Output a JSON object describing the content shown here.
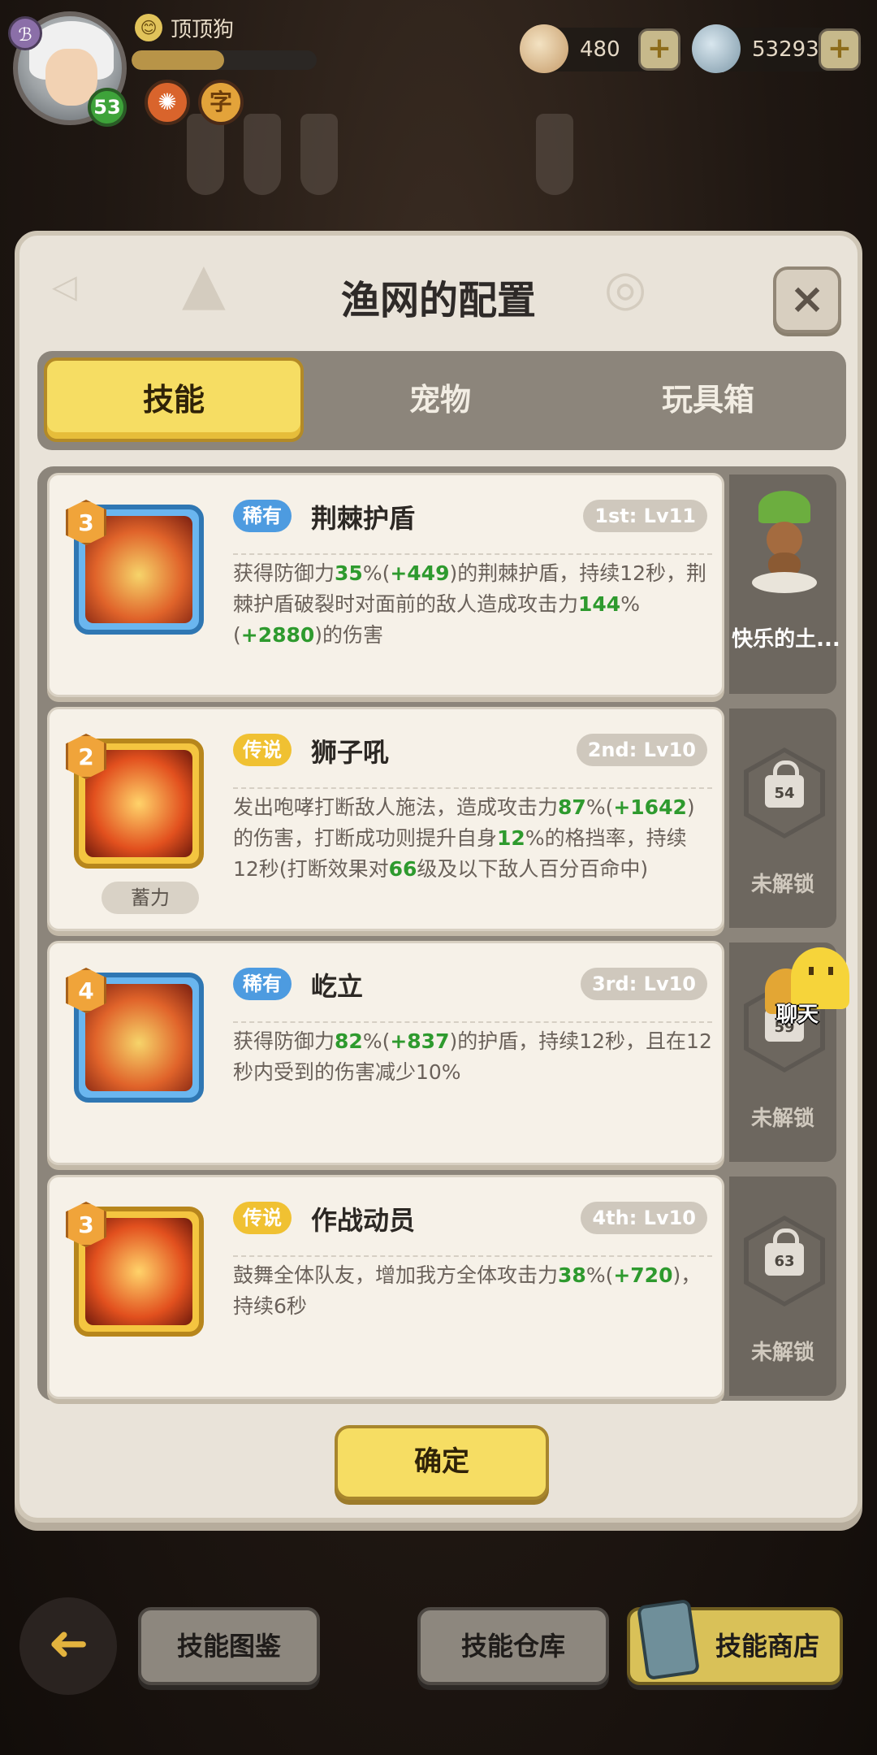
{
  "player": {
    "avatar_badge": "ℬ",
    "level": "53",
    "name_icon": "😊",
    "name": "顶顶狗",
    "xp_fraction": 0.5,
    "buffs": [
      {
        "icon": "✺"
      },
      {
        "icon": "字"
      }
    ]
  },
  "currencies": [
    {
      "name": "shell",
      "value": "480",
      "plus": "+"
    },
    {
      "name": "pearl",
      "value": "53293",
      "plus": "+"
    }
  ],
  "dialog": {
    "title": "渔网的配置",
    "close": "×",
    "tabs": [
      "技能",
      "宠物",
      "玩具箱"
    ],
    "active_tab": 0,
    "confirm": "确定"
  },
  "skills": [
    {
      "rank": "3",
      "rarity": "稀有",
      "rarity_type": "rare",
      "name": "荆棘护盾",
      "slot": "1st: Lv11",
      "desc": [
        {
          "t": "获得防御力"
        },
        {
          "t": "35",
          "h": true
        },
        {
          "t": "%("
        },
        {
          "t": "+449",
          "h": true
        },
        {
          "t": ")的荆棘护盾，持续12秒，荆棘护盾破裂时对面前的敌人造成攻击力"
        },
        {
          "t": "144",
          "h": true
        },
        {
          "t": "%("
        },
        {
          "t": "+2880",
          "h": true
        },
        {
          "t": ")的伤害"
        }
      ],
      "charge": "",
      "side": {
        "type": "pet",
        "name": "快乐的土..."
      },
      "icon_color": "blue"
    },
    {
      "rank": "2",
      "rarity": "传说",
      "rarity_type": "legend",
      "name": "狮子吼",
      "slot": "2nd: Lv10",
      "desc": [
        {
          "t": "发出咆哮打断敌人施法，造成攻击力"
        },
        {
          "t": "87",
          "h": true
        },
        {
          "t": "%("
        },
        {
          "t": "+1642",
          "h": true
        },
        {
          "t": ")的伤害，打断成功则提升自身"
        },
        {
          "t": "12",
          "h": true
        },
        {
          "t": "%的格挡率，持续12秒(打断效果对"
        },
        {
          "t": "66",
          "h": true
        },
        {
          "t": "级及以下敌人百分百命中)"
        }
      ],
      "charge": "蓄力",
      "side": {
        "type": "locked",
        "level": "54",
        "label": "未解锁"
      },
      "icon_color": "gold"
    },
    {
      "rank": "4",
      "rarity": "稀有",
      "rarity_type": "rare",
      "name": "屹立",
      "slot": "3rd: Lv10",
      "desc": [
        {
          "t": "获得防御力"
        },
        {
          "t": "82",
          "h": true
        },
        {
          "t": "%("
        },
        {
          "t": "+837",
          "h": true
        },
        {
          "t": ")的护盾，持续12秒，且在12秒内受到的伤害减少10%"
        }
      ],
      "charge": "",
      "side": {
        "type": "locked",
        "level": "59",
        "label": "未解锁"
      },
      "icon_color": "blue"
    },
    {
      "rank": "3",
      "rarity": "传说",
      "rarity_type": "legend",
      "name": "作战动员",
      "slot": "4th: Lv10",
      "desc": [
        {
          "t": "鼓舞全体队友，增加我方全体攻击力"
        },
        {
          "t": "38",
          "h": true
        },
        {
          "t": "%("
        },
        {
          "t": "+720",
          "h": true
        },
        {
          "t": ")，持续6秒"
        }
      ],
      "charge": "",
      "side": {
        "type": "locked",
        "level": "63",
        "label": "未解锁"
      },
      "icon_color": "gold"
    }
  ],
  "chat": {
    "label": "聊天"
  },
  "bottom_bar": {
    "back": "➜",
    "buttons": [
      "技能图鉴",
      "技能仓库",
      "技能商店"
    ]
  },
  "colors": {
    "highlight_green": "#2e9a2e",
    "tab_active": "#f6dd63",
    "rare_blue": "#4d9be0",
    "legend_gold": "#f0c132"
  }
}
